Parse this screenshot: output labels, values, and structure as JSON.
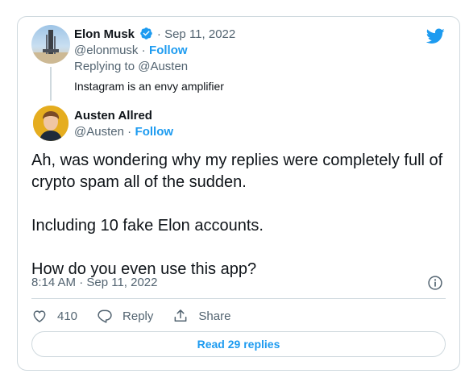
{
  "parent_tweet": {
    "author_name": "Elon Musk",
    "date": "· Sep 11, 2022",
    "handle": "@elonmusk ·",
    "follow_label": "Follow",
    "replying_to": "Replying to @Austen",
    "text": "Instagram is an envy amplifier"
  },
  "main_tweet": {
    "author_name": "Austen Allred",
    "handle": "@Austen ·",
    "follow_label": "Follow",
    "paragraphs": [
      "Ah, was wondering why my replies were completely full of crypto spam all of the sudden.",
      "Including 10 fake Elon accounts.",
      "How do you even use this app?"
    ],
    "timestamp": "8:14 AM · Sep 11, 2022"
  },
  "actions": {
    "like_count": "410",
    "reply_label": "Reply",
    "share_label": "Share"
  },
  "read_replies_label": "Read 29 replies",
  "icons": {
    "brand": "twitter-bird-icon",
    "verified": "verified-badge-icon",
    "info": "info-icon",
    "like": "heart-icon",
    "reply": "reply-bubble-icon",
    "share": "share-icon"
  },
  "colors": {
    "accent": "#1d9bf0",
    "text": "#0f1419",
    "muted": "#536471",
    "border": "#cfd9de"
  }
}
